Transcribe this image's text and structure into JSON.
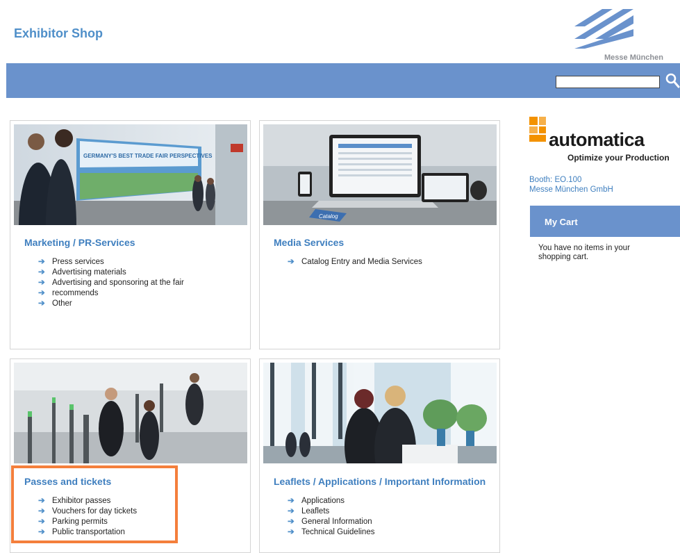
{
  "header": {
    "title": "Exhibitor Shop",
    "logo_text": "Messe München"
  },
  "search": {
    "placeholder": "",
    "icon": "search-icon"
  },
  "cards": [
    {
      "title": "Marketing / PR-Services",
      "items": [
        "Press services",
        "Advertising materials",
        "Advertising and sponsoring at the fair",
        "recommends",
        "Other"
      ],
      "image_banner": "GERMANY'S BEST TRADE FAIR PERSPECTIVES"
    },
    {
      "title": "Media Services",
      "items": [
        "Catalog Entry and Media Services"
      ],
      "image_label": "Catalog"
    },
    {
      "title": "Passes and tickets",
      "items": [
        "Exhibitor passes",
        "Vouchers for day tickets",
        "Parking permits",
        "Public transportation"
      ]
    },
    {
      "title": "Leaflets / Applications / Important Information",
      "items": [
        "Applications",
        "Leaflets",
        "General Information",
        "Technical Guidelines"
      ]
    }
  ],
  "sidebar": {
    "event_logo": "automatica",
    "event_tagline": "Optimize your Production",
    "booth": "Booth: EO.100",
    "company": "Messe München GmbH",
    "cart_title": "My Cart",
    "cart_message": "You have no items in your shopping cart."
  },
  "colors": {
    "accent": "#6a92cc",
    "link": "#3f7fbf",
    "highlight": "#f47f3c",
    "automatica_orange": "#f39200"
  }
}
